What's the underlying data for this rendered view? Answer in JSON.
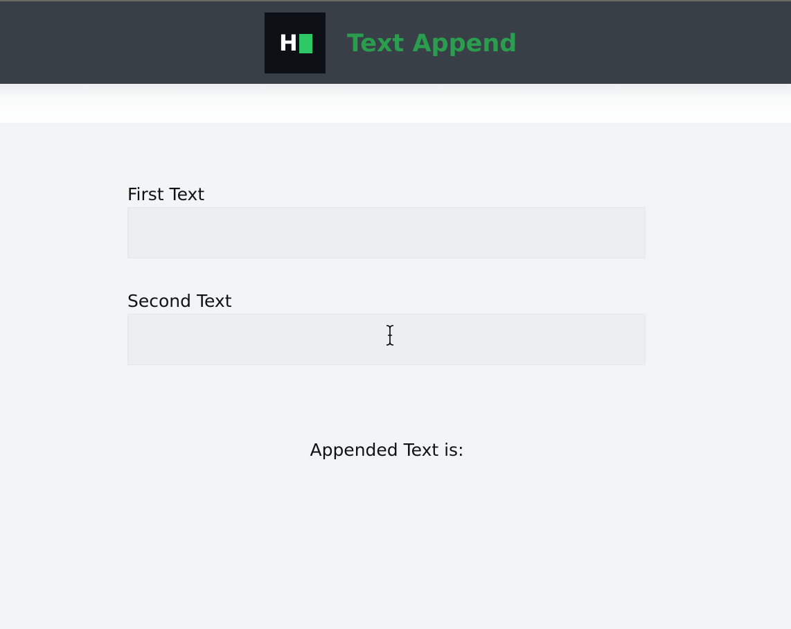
{
  "header": {
    "logo": {
      "letter": "H",
      "icon": "hackerrank-logo-icon",
      "background": "#0d1116",
      "accent": "#2ec866"
    },
    "title": "Text Append",
    "title_color": "#2a9d4f",
    "background": "#383f46"
  },
  "form": {
    "first_text": {
      "label": "First Text",
      "value": "",
      "placeholder": ""
    },
    "second_text": {
      "label": "Second Text",
      "value": "",
      "placeholder": ""
    }
  },
  "result": {
    "label": "Appended Text is:",
    "value": ""
  },
  "pointer": {
    "icon": "text-cursor-icon"
  }
}
